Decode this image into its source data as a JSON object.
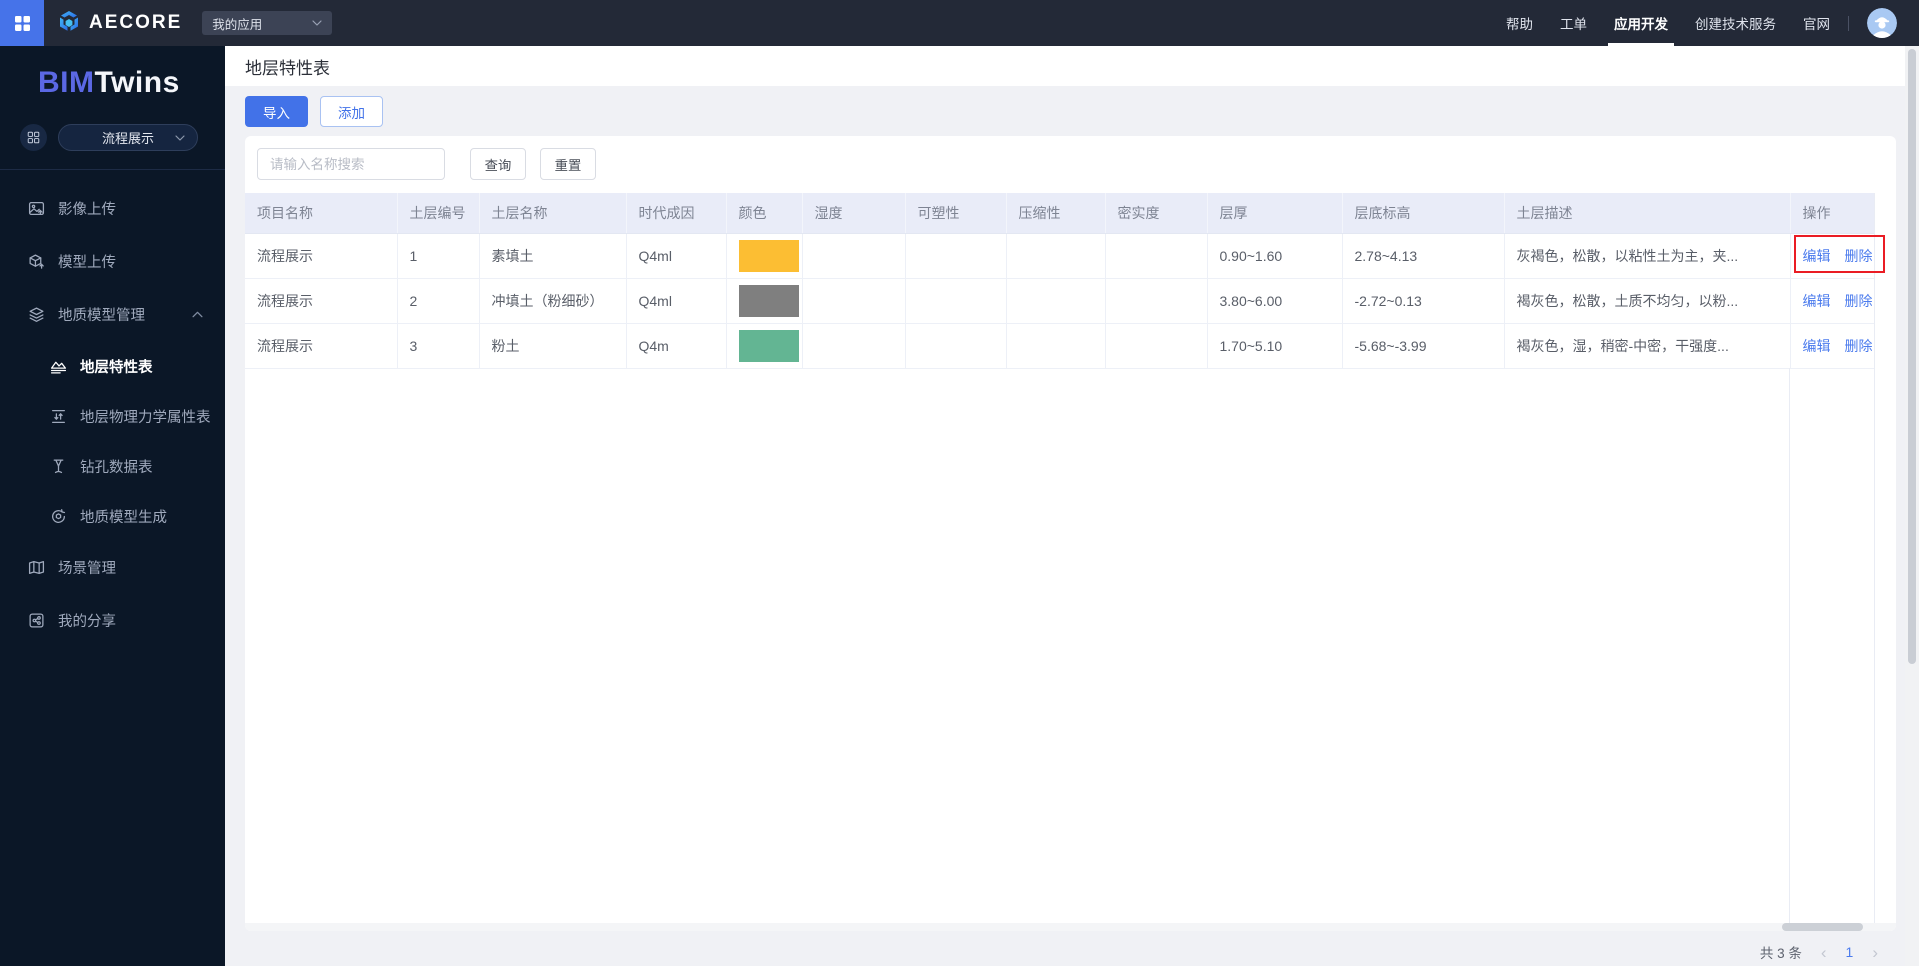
{
  "colors": {
    "accent": "#4272e8",
    "link": "#4b7bed",
    "highlight_red": "#ea1c24"
  },
  "topbar": {
    "logo_text": "AECORE",
    "app_select": {
      "value": "我的应用"
    },
    "menu": [
      {
        "label": "帮助"
      },
      {
        "label": "工单"
      },
      {
        "label": "应用开发",
        "active": true
      },
      {
        "label": "创建技术服务"
      },
      {
        "label": "官网"
      }
    ]
  },
  "sidebar": {
    "logo_bim": "BIM",
    "logo_twins": "Twins",
    "project_select": {
      "value": "流程展示"
    },
    "items": [
      {
        "label": "影像上传",
        "icon": "image-upload-icon"
      },
      {
        "label": "模型上传",
        "icon": "model-upload-icon"
      },
      {
        "label": "地质模型管理",
        "icon": "geology-layers-icon",
        "expanded": true,
        "children": [
          {
            "label": "地层特性表",
            "icon": "strata-table-icon",
            "active": true
          },
          {
            "label": "地层物理力学属性表",
            "icon": "physics-table-icon"
          },
          {
            "label": "钻孔数据表",
            "icon": "borehole-icon"
          },
          {
            "label": "地质模型生成",
            "icon": "model-generate-icon"
          }
        ]
      },
      {
        "label": "场景管理",
        "icon": "scene-manage-icon"
      },
      {
        "label": "我的分享",
        "icon": "my-share-icon"
      }
    ]
  },
  "page": {
    "title": "地层特性表",
    "import_btn": "导入",
    "add_btn": "添加",
    "search_placeholder": "请输入名称搜索",
    "query_btn": "查询",
    "reset_btn": "重置"
  },
  "table": {
    "columns": [
      "项目名称",
      "土层编号",
      "土层名称",
      "时代成因",
      "颜色",
      "湿度",
      "可塑性",
      "压缩性",
      "密实度",
      "层厚",
      "层底标高",
      "土层描述",
      "操作"
    ],
    "rows": [
      {
        "project": "流程展示",
        "layer_no": "1",
        "layer_name": "素填土",
        "era": "Q4ml",
        "color": "#fcbe33",
        "moisture": "",
        "plasticity": "",
        "compressibility": "",
        "density": "",
        "thickness": "0.90~1.60",
        "bottom_elevation": "2.78~4.13",
        "description": "灰褐色，松散，以粘性土为主，夹...",
        "highlighted": true
      },
      {
        "project": "流程展示",
        "layer_no": "2",
        "layer_name": "冲填土（粉细砂）",
        "era": "Q4ml",
        "color": "#7f7f7f",
        "moisture": "",
        "plasticity": "",
        "compressibility": "",
        "density": "",
        "thickness": "3.80~6.00",
        "bottom_elevation": "-2.72~0.13",
        "description": "褐灰色，松散，土质不均匀，以粉..."
      },
      {
        "project": "流程展示",
        "layer_no": "3",
        "layer_name": "粉土",
        "era": "Q4m",
        "color": "#63b593",
        "moisture": "",
        "plasticity": "",
        "compressibility": "",
        "density": "",
        "thickness": "1.70~5.10",
        "bottom_elevation": "-5.68~-3.99",
        "description": "褐灰色，湿，稍密-中密，干强度..."
      }
    ],
    "actions": {
      "edit": "编辑",
      "delete": "删除"
    }
  },
  "pagination": {
    "total_text": "共 3 条",
    "current_page": "1"
  }
}
